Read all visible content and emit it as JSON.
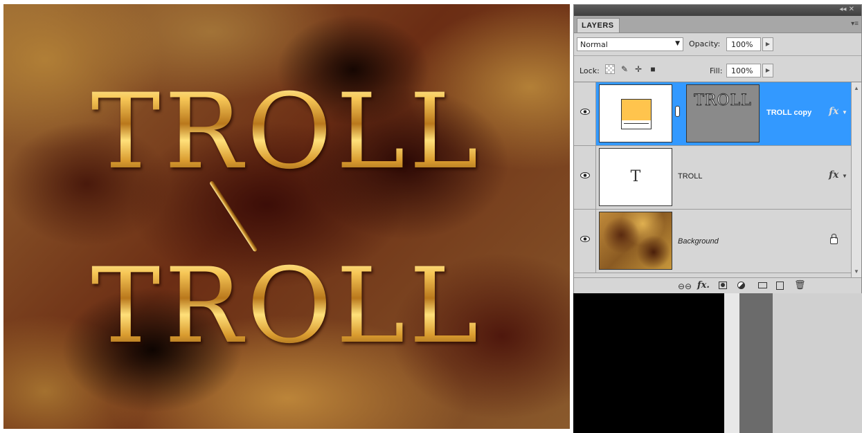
{
  "canvas": {
    "text_lines": [
      "TROLL",
      "TROLL"
    ]
  },
  "panel": {
    "tab_label": "LAYERS",
    "collapse_icon": "double-chevron-icon",
    "menu_icon": "panel-menu-icon",
    "blend_mode": "Normal",
    "opacity_label": "Opacity:",
    "opacity_value": "100%",
    "lock_label": "Lock:",
    "fill_label": "Fill:",
    "fill_value": "100%",
    "layers": [
      {
        "name": "TROLL copy",
        "selected": true,
        "has_fx": true,
        "mask_text": "TROLL"
      },
      {
        "name": "TROLL",
        "selected": false,
        "has_fx": true,
        "thumb_letter": "T"
      },
      {
        "name": "Background",
        "selected": false,
        "locked": true
      }
    ]
  },
  "colors": {
    "selection": "#3399ff",
    "fill_swatch": "#ffc44d"
  }
}
